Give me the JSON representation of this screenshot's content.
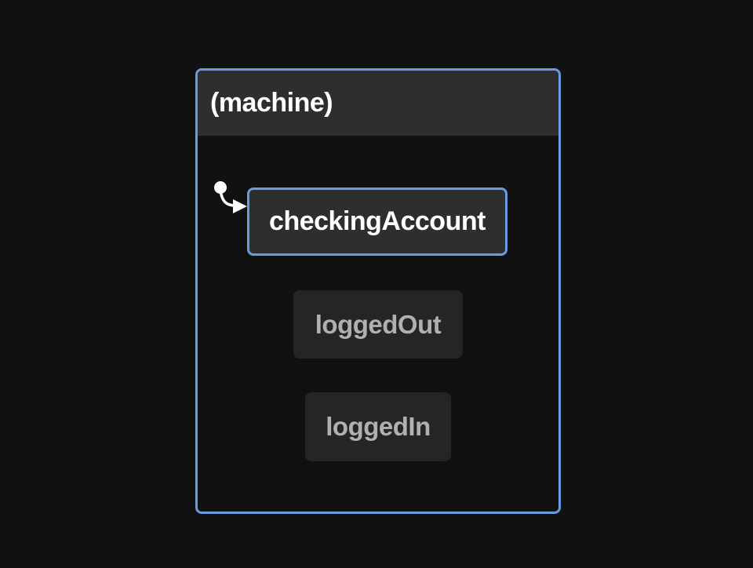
{
  "machine": {
    "title": "(machine)",
    "border_color": "#6a9ae0",
    "header_color": "#2e2e2e"
  },
  "states": {
    "initial": {
      "label": "checkingAccount",
      "active": true
    },
    "logged_out": {
      "label": "loggedOut",
      "active": false
    },
    "logged_in": {
      "label": "loggedIn",
      "active": false
    }
  },
  "colors": {
    "background": "#111111",
    "active_border": "#6a9ae0",
    "active_text": "#ffffff",
    "inactive_text": "#b0b0b0",
    "inactive_fill": "#252525"
  },
  "icons": {
    "initial_marker": "initial-state-arrow-icon"
  }
}
